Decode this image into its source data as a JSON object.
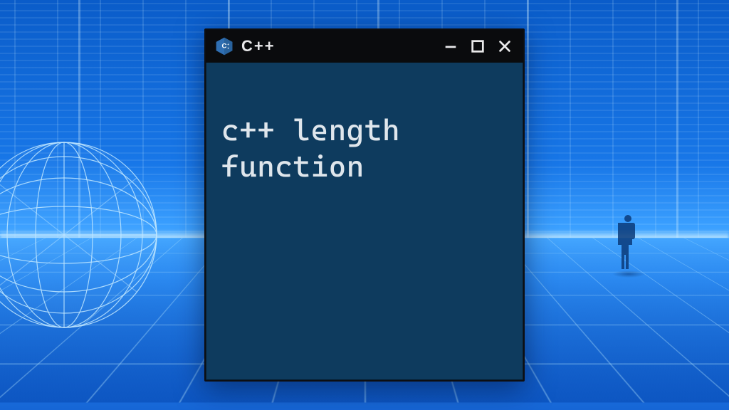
{
  "window": {
    "title": "C++",
    "icon_name": "cpp-icon"
  },
  "terminal": {
    "content": "c++ length\nfunction"
  },
  "colors": {
    "titlebar_bg": "#0a0b0d",
    "window_bg": "#0e3b5e",
    "text": "#dfe6ec",
    "accent_icon": "#2f6fb3"
  }
}
